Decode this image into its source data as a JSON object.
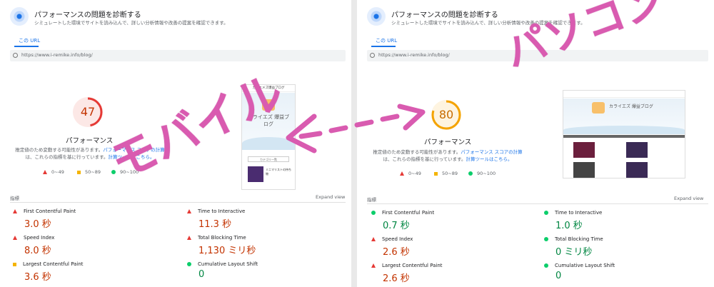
{
  "panels": [
    {
      "diag_title": "パフォーマンスの問題を診断する",
      "diag_sub": "シミュレートした環境でサイトを読み込んで、詳しい分析情報や改善の提案を確認できます。",
      "url_tab": "この URL",
      "url": "https://www.i-remike.info/blog/",
      "score": "47",
      "score_value": 47,
      "perf_label": "パフォーマンス",
      "perf_desc_1": "推定値のため変動する可能性があります。",
      "perf_desc_link1": "パフォーマンス スコアの計算",
      "perf_desc_2": "は、これらの指標を基に行っています。",
      "perf_desc_link2": "計算ツールはこちら。",
      "legend": [
        "0~49",
        "50~89",
        "90~100"
      ],
      "metrics_head": "指標",
      "expand": "Expand view",
      "metrics": [
        {
          "name": "First Contentful Paint",
          "value": "3.0 秒",
          "status": "fail"
        },
        {
          "name": "Time to Interactive",
          "value": "11.3 秒",
          "status": "fail"
        },
        {
          "name": "Speed Index",
          "value": "8.0 秒",
          "status": "fail"
        },
        {
          "name": "Total Blocking Time",
          "value": "1,130 ミリ秒",
          "status": "fail"
        },
        {
          "name": "Largest Contentful Paint",
          "value": "3.6 秒",
          "status": "average"
        },
        {
          "name": "Cumulative Layout Shift",
          "value": "0",
          "status": "pass"
        }
      ],
      "preview": {
        "topbar": "カイエメズ爆益ブログ",
        "brand": "カライエズ 爆益ブログ",
        "menu": "カテゴリ一覧",
        "card_text": "ミニマリストの持ち物"
      }
    },
    {
      "diag_title": "パフォーマンスの問題を診断する",
      "diag_sub": "シミュレートした環境でサイトを読み込んで、詳しい分析情報や改善の提案を確認できます。",
      "url_tab": "この URL",
      "url": "https://www.i-remike.info/blog/",
      "score": "80",
      "score_value": 80,
      "perf_label": "パフォーマンス",
      "perf_desc_1": "推定値のため変動する可能性があります。",
      "perf_desc_link1": "パフォーマンス スコアの計算",
      "perf_desc_2": "は、これらの指標を基に行っています。",
      "perf_desc_link2": "計算ツールはこちら。",
      "legend": [
        "0~49",
        "50~89",
        "90~100"
      ],
      "metrics_head": "指標",
      "expand": "Expand view",
      "metrics": [
        {
          "name": "First Contentful Paint",
          "value": "0.7 秒",
          "status": "pass"
        },
        {
          "name": "Time to Interactive",
          "value": "1.0 秒",
          "status": "pass"
        },
        {
          "name": "Speed Index",
          "value": "2.6 秒",
          "status": "fail"
        },
        {
          "name": "Total Blocking Time",
          "value": "0 ミリ秒",
          "status": "pass"
        },
        {
          "name": "Largest Contentful Paint",
          "value": "2.6 秒",
          "status": "fail"
        },
        {
          "name": "Cumulative Layout Shift",
          "value": "0",
          "status": "pass"
        }
      ],
      "preview": {
        "brand": "カライエズ 爆益ブログ"
      }
    }
  ],
  "annotations": {
    "mobile": "モバイル",
    "pc": "パソコン"
  },
  "colors": {
    "fail": "#e53935",
    "average": "#f4b400",
    "pass": "#0cce6b",
    "annotation": "#d95bb0"
  }
}
